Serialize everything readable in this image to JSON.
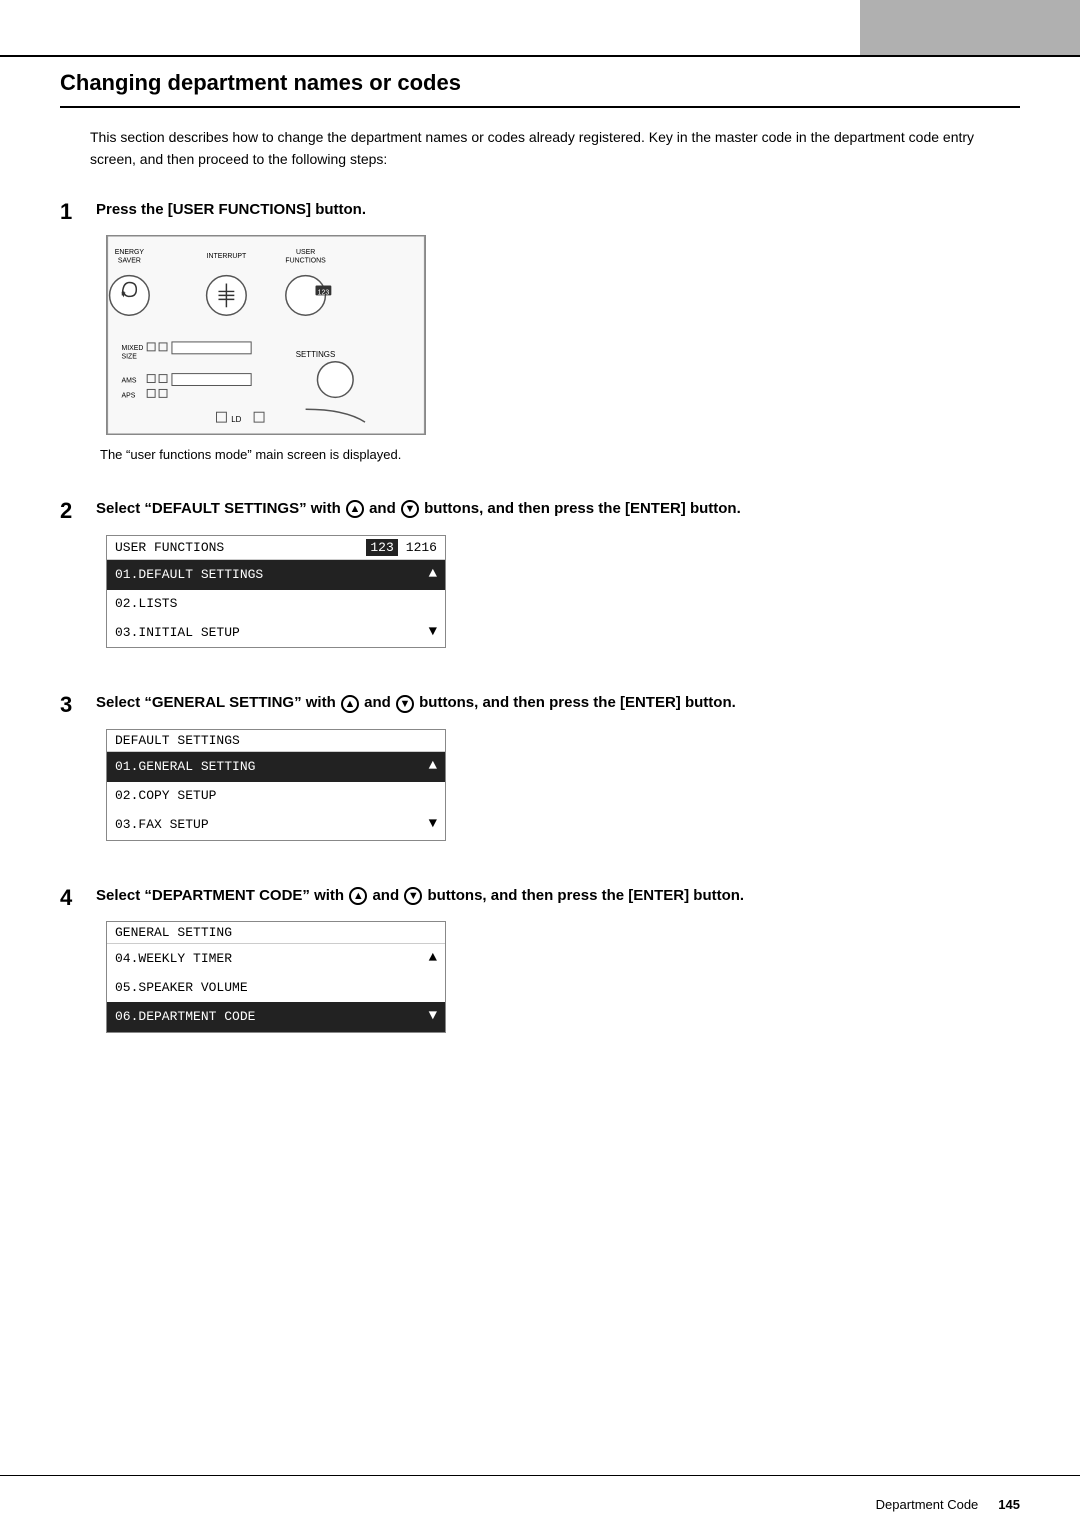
{
  "page": {
    "top_bar_color": "#b0b0b0",
    "section_title": "Changing department names or codes",
    "intro_text": "This section describes how to change the department names or codes already registered. Key in the master code in the department code entry screen, and then proceed to the following steps:",
    "steps": [
      {
        "number": "1",
        "instruction": "Press the [USER FUNCTIONS] button.",
        "note": "The “user functions mode” main screen is displayed.",
        "has_panel": true,
        "has_lcd": false
      },
      {
        "number": "2",
        "instruction_prefix": "Select “DEFAULT SETTINGS” with",
        "instruction_suffix": "buttons, and then press the [ENTER] button.",
        "and_text": "and",
        "has_panel": false,
        "has_lcd": true,
        "lcd_id": "lcd1",
        "lcd_header": "USER FUNCTIONS",
        "lcd_badge": "123",
        "lcd_page": "1216",
        "lcd_rows": [
          {
            "text": "01.DEFAULT SETTINGS",
            "selected": true,
            "arrow": "▲"
          },
          {
            "text": "02.LISTS",
            "selected": false,
            "arrow": ""
          },
          {
            "text": "03.INITIAL SETUP",
            "selected": false,
            "arrow": "▼"
          }
        ]
      },
      {
        "number": "3",
        "instruction_prefix": "Select “GENERAL SETTING” with",
        "instruction_suffix": "buttons, and then press the [ENTER] button.",
        "and_text": "and",
        "has_panel": false,
        "has_lcd": true,
        "lcd_id": "lcd2",
        "lcd_header": "DEFAULT SETTINGS",
        "lcd_badge": "",
        "lcd_page": "",
        "lcd_rows": [
          {
            "text": "01.GENERAL SETTING",
            "selected": true,
            "arrow": "▲"
          },
          {
            "text": "02.COPY SETUP",
            "selected": false,
            "arrow": ""
          },
          {
            "text": "03.FAX SETUP",
            "selected": false,
            "arrow": "▼"
          }
        ]
      },
      {
        "number": "4",
        "instruction_prefix": "Select “DEPARTMENT CODE” with",
        "instruction_suffix": "buttons, and then press the [ENTER] button.",
        "and_text": "and",
        "has_panel": false,
        "has_lcd": true,
        "lcd_id": "lcd3",
        "lcd_header": "GENERAL SETTING",
        "lcd_badge": "",
        "lcd_page": "",
        "lcd_rows": [
          {
            "text": "04.WEEKLY TIMER",
            "selected": false,
            "arrow": "▲"
          },
          {
            "text": "05.SPEAKER VOLUME",
            "selected": false,
            "arrow": ""
          },
          {
            "text": "06.DEPARTMENT CODE",
            "selected": true,
            "arrow": "▼"
          }
        ]
      }
    ],
    "footer": {
      "label": "Department Code",
      "page": "145"
    }
  }
}
